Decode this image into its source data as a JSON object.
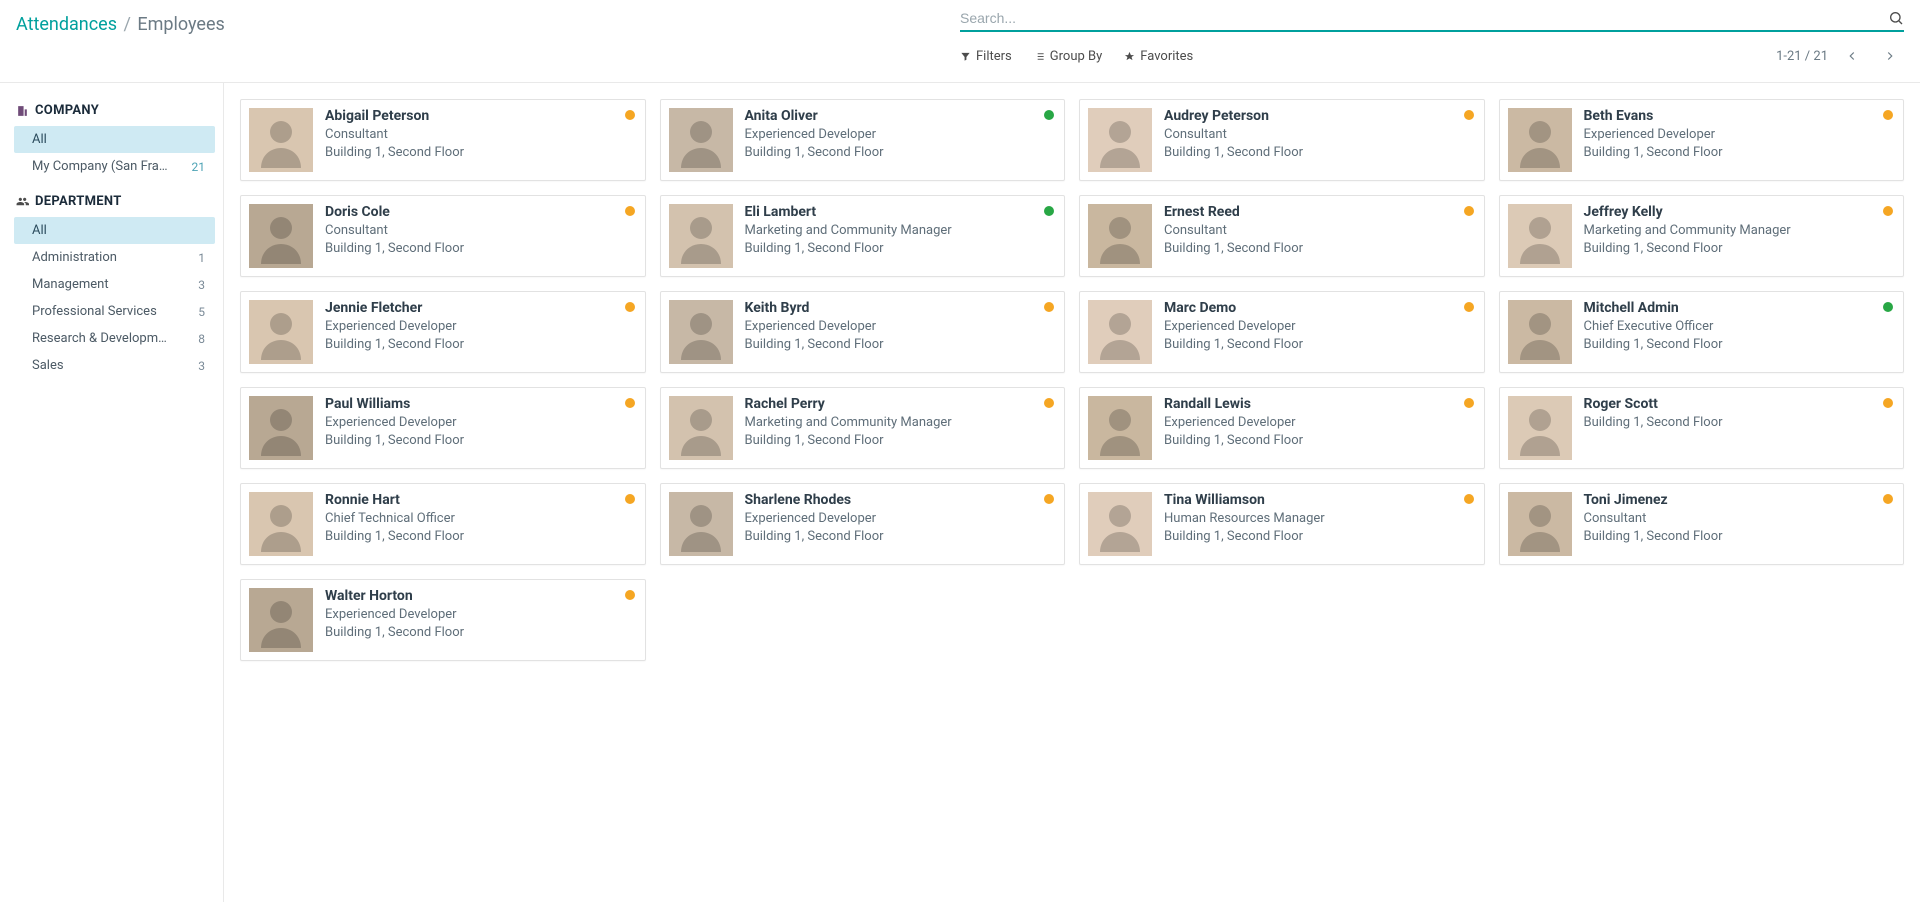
{
  "breadcrumb": {
    "root": "Attendances",
    "sep": "/",
    "current": "Employees"
  },
  "search": {
    "placeholder": "Search..."
  },
  "controls": {
    "filters": "Filters",
    "groupby": "Group By",
    "favorites": "Favorites",
    "pager": "1-21 / 21"
  },
  "sidebar": {
    "company_heading": "COMPANY",
    "department_heading": "DEPARTMENT",
    "company_items": [
      {
        "label": "All",
        "count": "",
        "selected": true
      },
      {
        "label": "My Company (San Franci...",
        "count": "21",
        "selected": false
      }
    ],
    "department_items": [
      {
        "label": "All",
        "count": "",
        "selected": true
      },
      {
        "label": "Administration",
        "count": "1",
        "selected": false
      },
      {
        "label": "Management",
        "count": "3",
        "selected": false
      },
      {
        "label": "Professional Services",
        "count": "5",
        "selected": false
      },
      {
        "label": "Research & Development",
        "count": "8",
        "selected": false
      },
      {
        "label": "Sales",
        "count": "3",
        "selected": false
      }
    ]
  },
  "employees": [
    {
      "name": "Abigail Peterson",
      "role": "Consultant",
      "location": "Building 1, Second Floor",
      "status": "amber"
    },
    {
      "name": "Anita Oliver",
      "role": "Experienced Developer",
      "location": "Building 1, Second Floor",
      "status": "green"
    },
    {
      "name": "Audrey Peterson",
      "role": "Consultant",
      "location": "Building 1, Second Floor",
      "status": "amber"
    },
    {
      "name": "Beth Evans",
      "role": "Experienced Developer",
      "location": "Building 1, Second Floor",
      "status": "amber"
    },
    {
      "name": "Doris Cole",
      "role": "Consultant",
      "location": "Building 1, Second Floor",
      "status": "amber"
    },
    {
      "name": "Eli Lambert",
      "role": "Marketing and Community Manager",
      "location": "Building 1, Second Floor",
      "status": "green"
    },
    {
      "name": "Ernest Reed",
      "role": "Consultant",
      "location": "Building 1, Second Floor",
      "status": "amber"
    },
    {
      "name": "Jeffrey Kelly",
      "role": "Marketing and Community Manager",
      "location": "Building 1, Second Floor",
      "status": "amber"
    },
    {
      "name": "Jennie Fletcher",
      "role": "Experienced Developer",
      "location": "Building 1, Second Floor",
      "status": "amber"
    },
    {
      "name": "Keith Byrd",
      "role": "Experienced Developer",
      "location": "Building 1, Second Floor",
      "status": "amber"
    },
    {
      "name": "Marc Demo",
      "role": "Experienced Developer",
      "location": "Building 1, Second Floor",
      "status": "amber"
    },
    {
      "name": "Mitchell Admin",
      "role": "Chief Executive Officer",
      "location": "Building 1, Second Floor",
      "status": "green"
    },
    {
      "name": "Paul Williams",
      "role": "Experienced Developer",
      "location": "Building 1, Second Floor",
      "status": "amber"
    },
    {
      "name": "Rachel Perry",
      "role": "Marketing and Community Manager",
      "location": "Building 1, Second Floor",
      "status": "amber"
    },
    {
      "name": "Randall Lewis",
      "role": "Experienced Developer",
      "location": "Building 1, Second Floor",
      "status": "amber"
    },
    {
      "name": "Roger Scott",
      "role": "",
      "location": "Building 1, Second Floor",
      "status": "amber"
    },
    {
      "name": "Ronnie Hart",
      "role": "Chief Technical Officer",
      "location": "Building 1, Second Floor",
      "status": "amber"
    },
    {
      "name": "Sharlene Rhodes",
      "role": "Experienced Developer",
      "location": "Building 1, Second Floor",
      "status": "amber"
    },
    {
      "name": "Tina Williamson",
      "role": "Human Resources Manager",
      "location": "Building 1, Second Floor",
      "status": "amber"
    },
    {
      "name": "Toni Jimenez",
      "role": "Consultant",
      "location": "Building 1, Second Floor",
      "status": "amber"
    },
    {
      "name": "Walter Horton",
      "role": "Experienced Developer",
      "location": "Building 1, Second Floor",
      "status": "amber"
    }
  ],
  "avatar_colors": [
    "#d9c6b0",
    "#c7b8a6",
    "#e0cdbb",
    "#cbb9a3",
    "#b8a893",
    "#d3c2ae",
    "#c9b79f",
    "#dccab6"
  ]
}
